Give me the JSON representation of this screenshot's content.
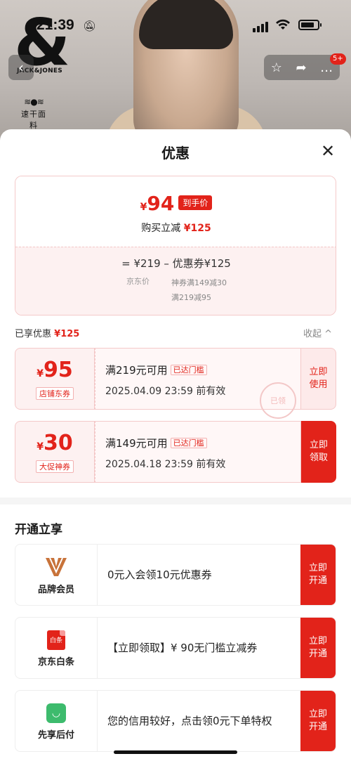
{
  "status_bar": {
    "time": "21:39"
  },
  "brand": {
    "logo_mark": "&",
    "logo_name": "JACK&JONES",
    "fabric_label": "速干面料",
    "notification_count": "5+"
  },
  "sheet": {
    "title": "优惠",
    "price": {
      "yen": "¥",
      "final": "94",
      "final_tag": "到手价",
      "save_text": "购买立减",
      "save_amount": "¥125",
      "formula": "= ¥219 – 优惠券¥125",
      "orig_label": "京东价",
      "coupon_detail_1": "神券满149减30",
      "coupon_detail_2": "满219减95"
    },
    "enjoyed_label": "已享优惠",
    "enjoyed_amount": "¥125",
    "collapse_label": "收起 ^",
    "coupons": [
      {
        "yen": "¥",
        "amount": "95",
        "tag": "店铺东券",
        "condition": "满219元可用",
        "status": "已达门槛",
        "valid": "2025.04.09 23:59 前有效",
        "action": "立即使用",
        "stamp": "已领"
      },
      {
        "yen": "¥",
        "amount": "30",
        "tag": "大促神券",
        "condition": "满149元可用",
        "status": "已达门槛",
        "valid": "2025.04.18 23:59 前有效",
        "action": "立即领取"
      }
    ],
    "section_title": "开通立享",
    "members": [
      {
        "name": "品牌会员",
        "text": "0元入会领10元优惠券",
        "action": "立即开通"
      },
      {
        "name": "京东白条",
        "icon_text": "白条",
        "text": "【立即领取】¥ 90无门槛立减券",
        "action": "立即开通"
      },
      {
        "name": "先享后付",
        "text": "您的信用较好，点击领0元下单特权",
        "action": "立即开通"
      }
    ]
  },
  "colors": {
    "accent": "#e2231a",
    "pale": "#fdf1f1",
    "green": "#3dbb6d",
    "vip_gold": "#c8733a"
  }
}
